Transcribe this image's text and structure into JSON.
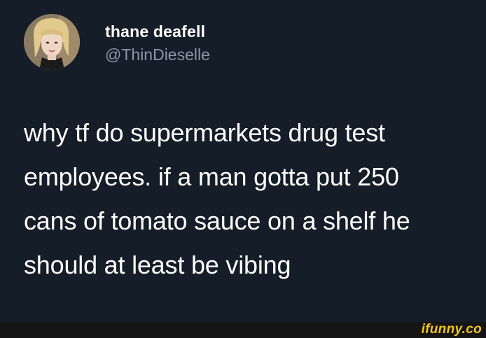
{
  "author": {
    "display_name": "thane deafell",
    "handle": "@ThinDieselle",
    "avatar_icon": "profile-photo"
  },
  "tweet": {
    "lines": [
      "why tf do supermarkets drug test",
      "employees. if a man gotta put 250",
      "cans of tomato sauce on a shelf he",
      "should at least be vibing"
    ]
  },
  "watermark": {
    "text": "ifunny.co"
  },
  "colors": {
    "background": "#151d28",
    "text": "#ffffff",
    "handle": "#8a97a6",
    "watermark": "#f5c518"
  }
}
